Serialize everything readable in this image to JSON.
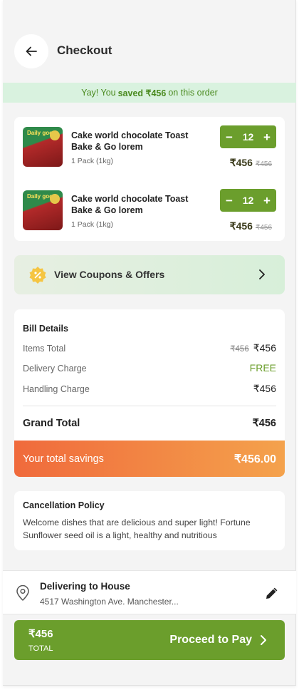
{
  "header": {
    "title": "Checkout",
    "back_icon": "arrow-left-icon"
  },
  "savings_banner": {
    "prefix": "Yay! You",
    "highlight": "saved ₹456",
    "suffix": "on this order"
  },
  "cart": {
    "items": [
      {
        "name": "Cake world chocolate Toast Bake & Go lorem",
        "pack": "1 Pack (1kg)",
        "brand": "Daily good",
        "qty": "12",
        "price": "₹456",
        "old_price": "₹456"
      },
      {
        "name": "Cake world chocolate Toast Bake & Go lorem",
        "pack": "1 Pack (1kg)",
        "brand": "Daily good",
        "qty": "12",
        "price": "₹456",
        "old_price": "₹456"
      }
    ],
    "minus_symbol": "−",
    "plus_symbol": "+"
  },
  "coupons": {
    "label": "View Coupons & Offers",
    "icon": "percent-badge-icon"
  },
  "bill": {
    "title": "Bill Details",
    "items_total_label": "Items Total",
    "items_total_old": "₹456",
    "items_total_value": "₹456",
    "delivery_label": "Delivery Charge",
    "delivery_value": "FREE",
    "handling_label": "Handling Charge",
    "handling_value": "₹456",
    "grand_label": "Grand Total",
    "grand_value": "₹456"
  },
  "total_savings": {
    "label": "Your total savings",
    "value": "₹456.00"
  },
  "policy": {
    "title": "Cancellation Policy",
    "text": "Welcome dishes that are delicious and super light! Fortune Sunflower seed oil is a light, healthy and nutritious"
  },
  "delivery": {
    "title": "Delivering to House",
    "address": "4517 Washington Ave. Manchester..."
  },
  "pay": {
    "amount": "₹456",
    "sub": "TOTAL",
    "label": "Proceed to Pay"
  },
  "colors": {
    "accent_green": "#6b9e2c",
    "banner_bg": "#d9f2df",
    "savings_gradient_start": "#f06a3c",
    "savings_gradient_end": "#f4a24c",
    "coupon_icon": "#f5c542"
  }
}
